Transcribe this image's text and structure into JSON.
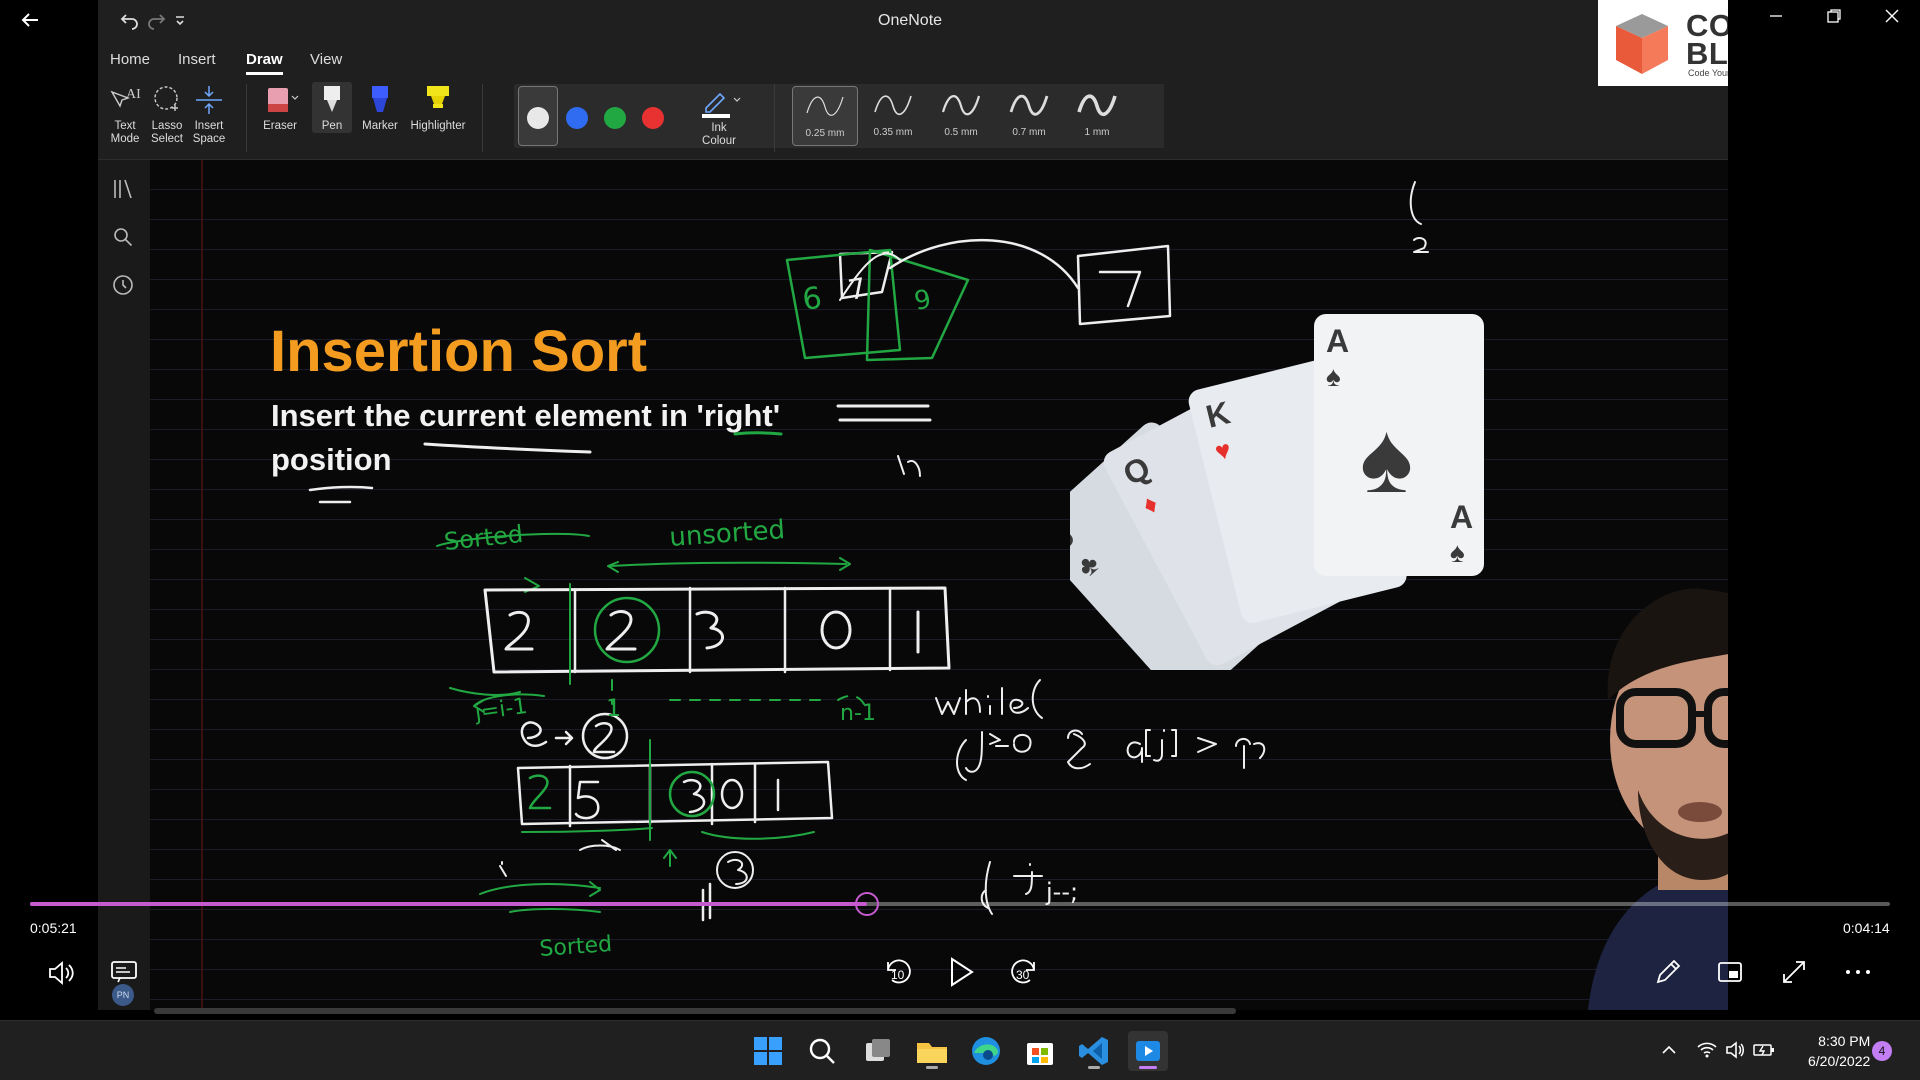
{
  "onenote": {
    "title": "OneNote",
    "tabs": [
      {
        "label": "Home"
      },
      {
        "label": "Insert"
      },
      {
        "label": "Draw"
      },
      {
        "label": "View"
      }
    ],
    "ribbon": {
      "text_mode": "Text Mode",
      "lasso_select": "Lasso Select",
      "insert_space": "Insert Space",
      "eraser": "Eraser",
      "pen": "Pen",
      "marker": "Marker",
      "highlighter": "Highlighter",
      "ink_colour": "Ink Colour",
      "ink_colour_1": "Ink",
      "ink_colour_2": "Colour",
      "text_mode_1": "Text",
      "text_mode_2": "Mode",
      "lasso_1": "Lasso",
      "lasso_2": "Select",
      "insert_1": "Insert",
      "insert_2": "Space",
      "pen_colors": [
        "#e8e8e8",
        "#2f6cf2",
        "#22a842",
        "#e83232"
      ],
      "thickness": [
        "0.25 mm",
        "0.35 mm",
        "0.5 mm",
        "0.7 mm",
        "1 mm"
      ]
    }
  },
  "slide": {
    "title": "Insertion Sort",
    "subtitle_line1": "Insert the current element in 'right'",
    "subtitle_line2": "position"
  },
  "logo": {
    "line1": "CODING",
    "line2": "BLOCKS",
    "tagline": "Code Your Way To Success"
  },
  "player": {
    "elapsed": "0:05:21",
    "remaining": "0:04:14",
    "progress_fraction": 0.45,
    "skip_back": "10",
    "skip_forward": "30",
    "avatar_initials": "PN"
  },
  "taskbar": {
    "time": "8:30 PM",
    "date": "6/20/2022",
    "notification_count": "4"
  }
}
